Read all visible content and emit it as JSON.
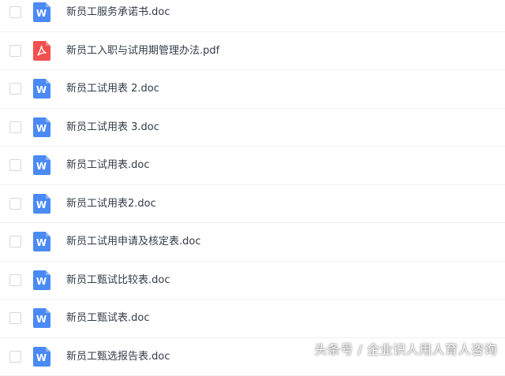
{
  "colors": {
    "word_icon": "#4a8af4",
    "pdf_icon": "#f1504f",
    "text": "#333c48",
    "divider": "#eef0f3"
  },
  "files": [
    {
      "name": "新员工服务承诺书.doc",
      "type": "word",
      "icon": "word-icon"
    },
    {
      "name": "新员工入职与试用期管理办法.pdf",
      "type": "pdf",
      "icon": "pdf-icon"
    },
    {
      "name": "新员工试用表 2.doc",
      "type": "word",
      "icon": "word-icon"
    },
    {
      "name": "新员工试用表 3.doc",
      "type": "word",
      "icon": "word-icon"
    },
    {
      "name": "新员工试用表.doc",
      "type": "word",
      "icon": "word-icon"
    },
    {
      "name": "新员工试用表2.doc",
      "type": "word",
      "icon": "word-icon"
    },
    {
      "name": "新员工试用申请及核定表.doc",
      "type": "word",
      "icon": "word-icon"
    },
    {
      "name": "新员工甄试比较表.doc",
      "type": "word",
      "icon": "word-icon"
    },
    {
      "name": "新员工甄试表.doc",
      "type": "word",
      "icon": "word-icon"
    },
    {
      "name": "新员工甄选报告表.doc",
      "type": "word",
      "icon": "word-icon"
    }
  ],
  "watermark": "头条号 / 企业识人用人育人咨询"
}
